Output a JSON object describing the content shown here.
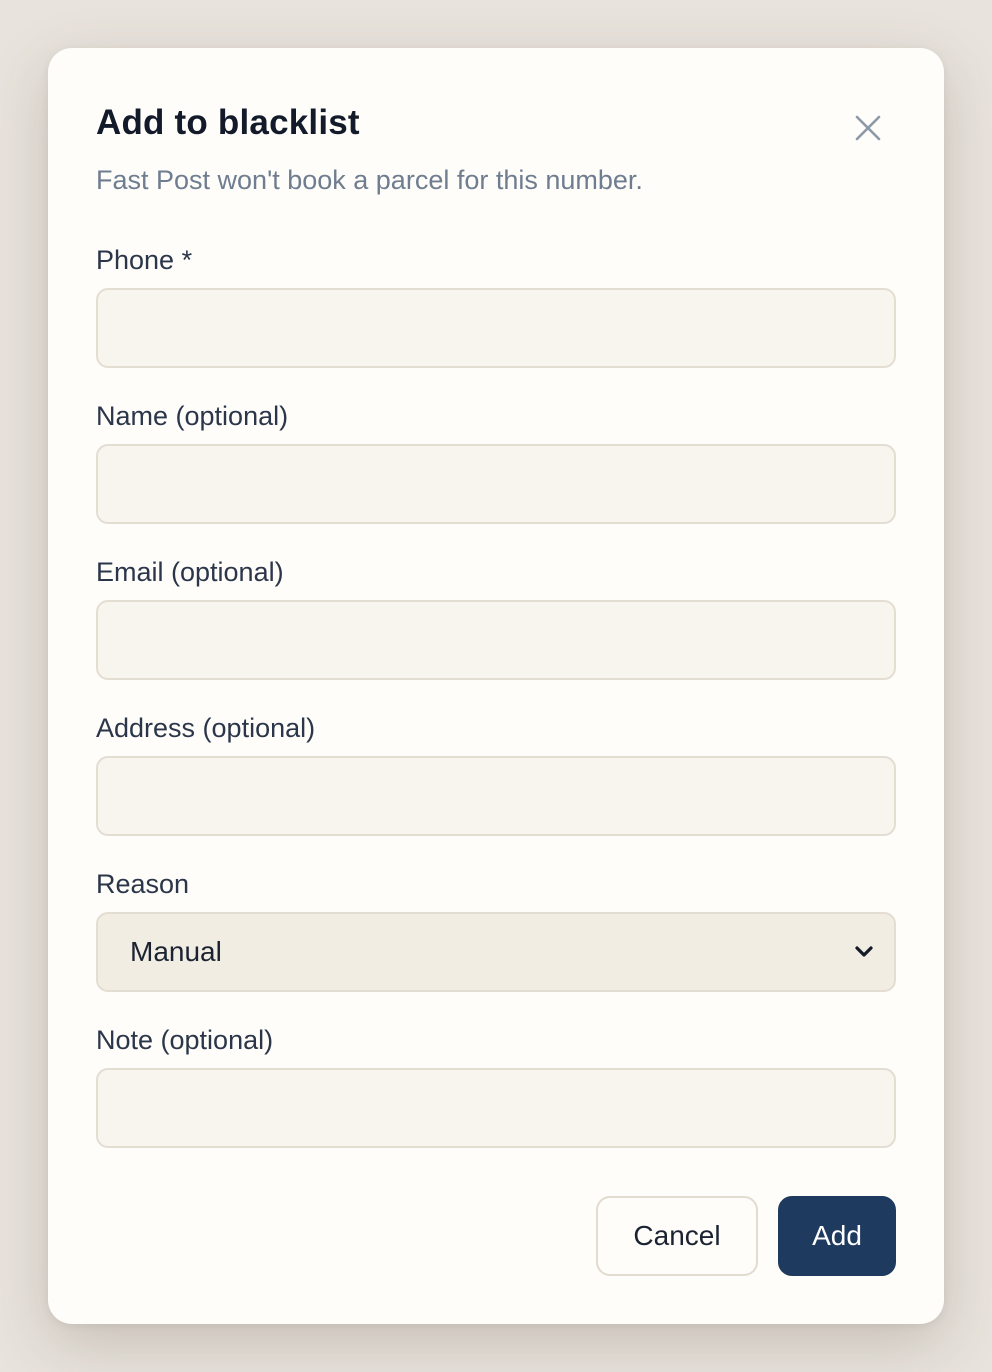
{
  "dialog": {
    "title": "Add to blacklist",
    "subtitle": "Fast Post won't book a parcel for this number."
  },
  "fields": {
    "phone": {
      "label": "Phone *",
      "value": "",
      "placeholder": ""
    },
    "name": {
      "label": "Name (optional)",
      "value": "",
      "placeholder": ""
    },
    "email": {
      "label": "Email (optional)",
      "value": "",
      "placeholder": ""
    },
    "address": {
      "label": "Address (optional)",
      "value": "",
      "placeholder": ""
    },
    "reason": {
      "label": "Reason",
      "selected": "Manual"
    },
    "note": {
      "label": "Note (optional)",
      "value": "",
      "placeholder": ""
    }
  },
  "actions": {
    "cancel_label": "Cancel",
    "add_label": "Add"
  },
  "icons": {
    "close": "close-icon",
    "dropdown": "chevron-down-icon"
  },
  "colors": {
    "primary": "#1f3a5f",
    "background": "#e8e3dc",
    "surface": "#fefdf9",
    "muted_text": "#6f7d90"
  }
}
